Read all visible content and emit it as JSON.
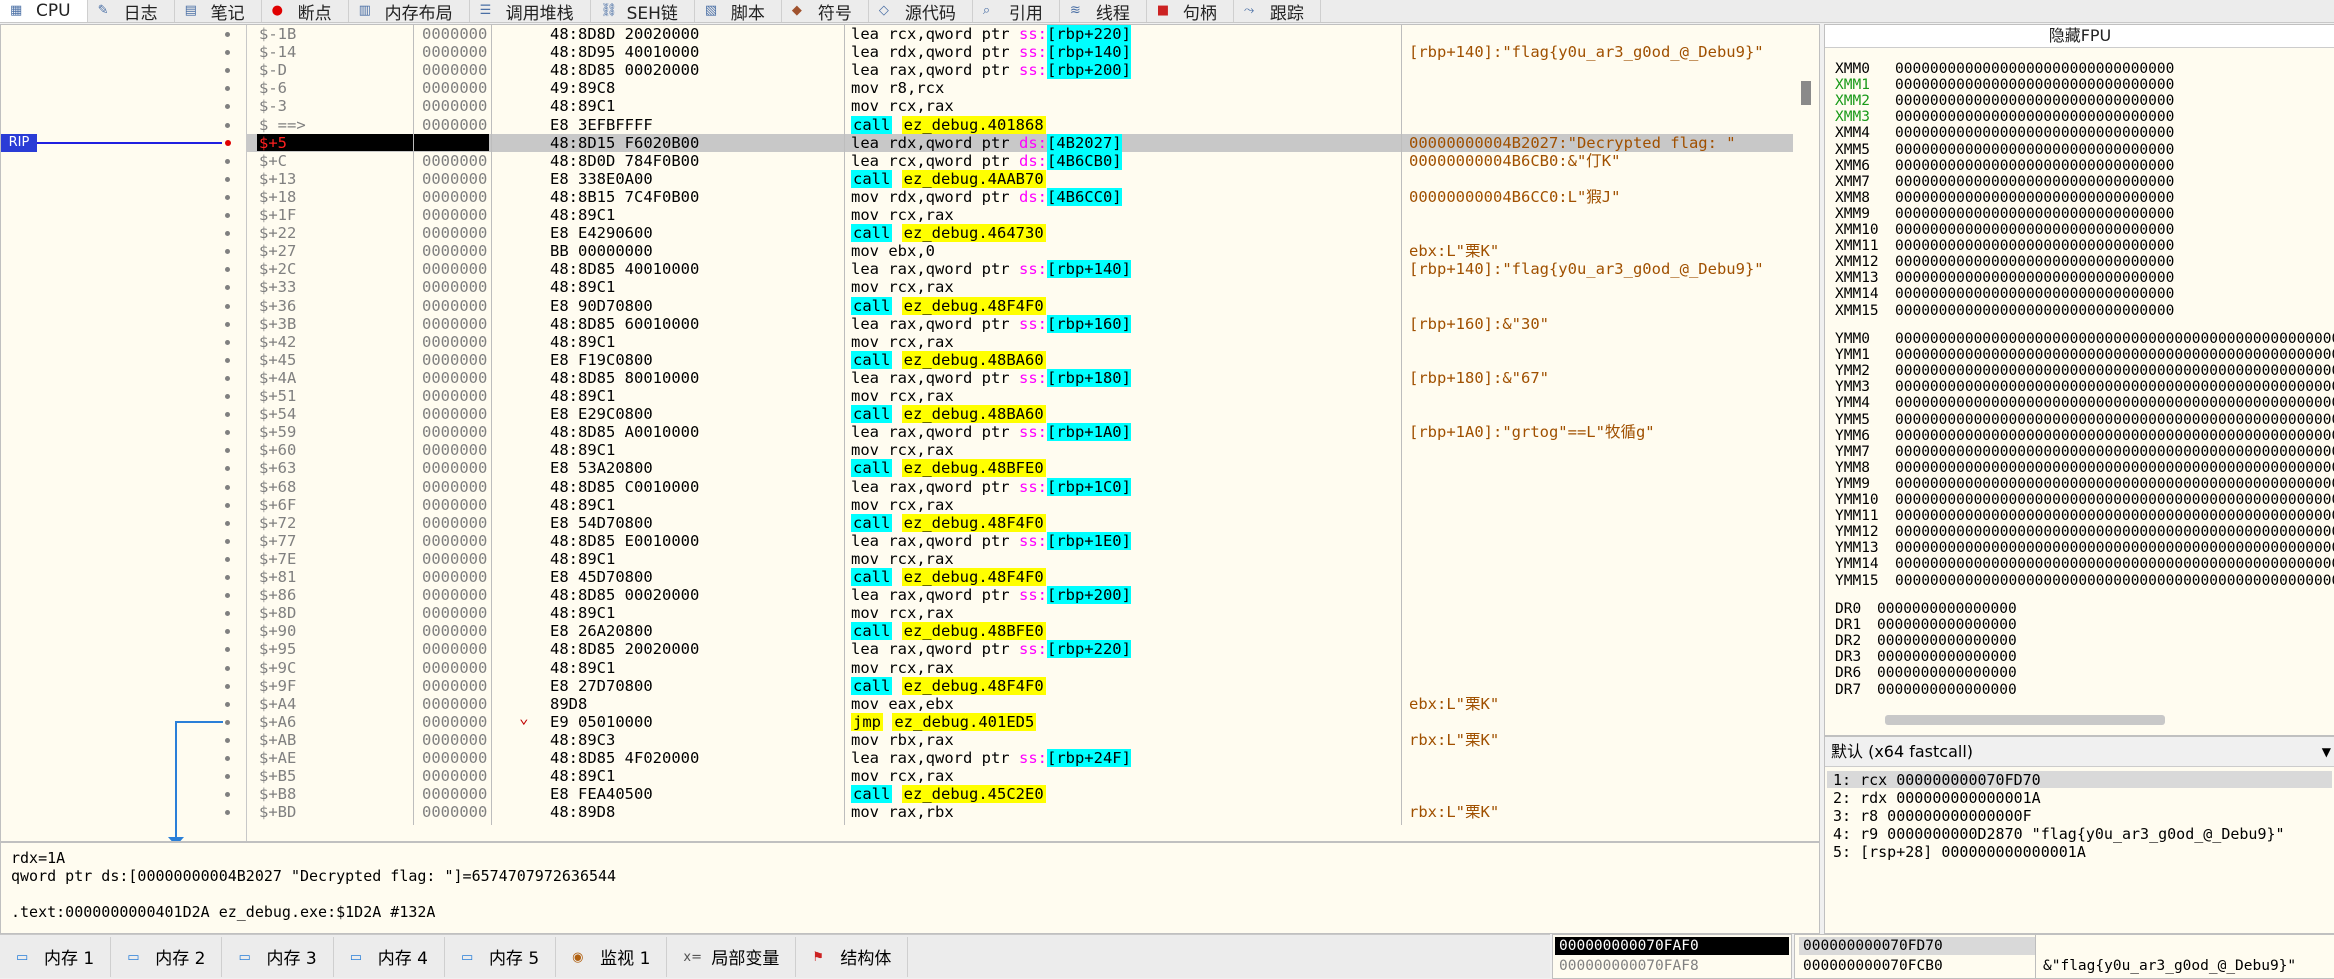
{
  "tabs": [
    {
      "label": "CPU",
      "icon": "cpu-icon",
      "active": true
    },
    {
      "label": "日志",
      "icon": "log-icon"
    },
    {
      "label": "笔记",
      "icon": "notes-icon"
    },
    {
      "label": "断点",
      "icon": "breakpoint-icon"
    },
    {
      "label": "内存布局",
      "icon": "memory-map-icon"
    },
    {
      "label": "调用堆栈",
      "icon": "call-stack-icon"
    },
    {
      "label": "SEH链",
      "icon": "seh-icon"
    },
    {
      "label": "脚本",
      "icon": "script-icon"
    },
    {
      "label": "符号",
      "icon": "symbols-icon"
    },
    {
      "label": "源代码",
      "icon": "source-icon"
    },
    {
      "label": "引用",
      "icon": "references-icon"
    },
    {
      "label": "线程",
      "icon": "threads-icon"
    },
    {
      "label": "句柄",
      "icon": "handles-icon"
    },
    {
      "label": "跟踪",
      "icon": "trace-icon"
    }
  ],
  "disasm": {
    "rip_label": "RIP",
    "rows": [
      {
        "label": "$-1B",
        "addr": "0000000",
        "bytes": "48:8D8D 20020000",
        "instr": [
          [
            "t",
            "lea rcx,qword ptr "
          ],
          [
            "s",
            "ss:"
          ],
          [
            "b",
            "[rbp+220]"
          ]
        ],
        "cmt": ""
      },
      {
        "label": "$-14",
        "addr": "0000000",
        "bytes": "48:8D95 40010000",
        "instr": [
          [
            "t",
            "lea rdx,qword ptr "
          ],
          [
            "s",
            "ss:"
          ],
          [
            "b",
            "[rbp+140]"
          ]
        ],
        "cmt": "[rbp+140]:\"flag{y0u_ar3_g0od_@_Debu9}\""
      },
      {
        "label": "$-D",
        "addr": "0000000",
        "bytes": "48:8D85 00020000",
        "instr": [
          [
            "t",
            "lea rax,qword ptr "
          ],
          [
            "s",
            "ss:"
          ],
          [
            "b",
            "[rbp+200]"
          ]
        ],
        "cmt": ""
      },
      {
        "label": "$-6",
        "addr": "0000000",
        "bytes": "49:89C8",
        "instr": [
          [
            "t",
            "mov r8,rcx"
          ]
        ],
        "cmt": ""
      },
      {
        "label": "$-3",
        "addr": "0000000",
        "bytes": "48:89C1",
        "instr": [
          [
            "t",
            "mov rcx,rax"
          ]
        ],
        "cmt": ""
      },
      {
        "label": "$ ==>",
        "addr": "0000000",
        "bytes": "E8 3EFBFFFF",
        "instr": [
          [
            "c",
            "call"
          ],
          [
            "t",
            " "
          ],
          [
            "y",
            "ez_debug.401868"
          ]
        ],
        "cmt": ""
      },
      {
        "label": "$+5",
        "addr": "0000000",
        "bytes": "48:8D15 F6020B00",
        "instr": [
          [
            "t",
            "lea rdx,qword ptr "
          ],
          [
            "s",
            "ds:"
          ],
          [
            "b",
            "[4B2027]"
          ]
        ],
        "cmt": "00000000004B2027:\"Decrypted flag: \"",
        "rip": true
      },
      {
        "label": "$+C",
        "addr": "0000000",
        "bytes": "48:8D0D 784F0B00",
        "instr": [
          [
            "t",
            "lea rcx,qword ptr "
          ],
          [
            "s",
            "ds:"
          ],
          [
            "b",
            "[4B6CB0]"
          ]
        ],
        "cmt": "00000000004B6CB0:&\"仃K\""
      },
      {
        "label": "$+13",
        "addr": "0000000",
        "bytes": "E8 338E0A00",
        "instr": [
          [
            "c",
            "call"
          ],
          [
            "t",
            " "
          ],
          [
            "y",
            "ez_debug.4AAB70"
          ]
        ],
        "cmt": ""
      },
      {
        "label": "$+18",
        "addr": "0000000",
        "bytes": "48:8B15 7C4F0B00",
        "instr": [
          [
            "t",
            "mov rdx,qword ptr "
          ],
          [
            "s",
            "ds:"
          ],
          [
            "b",
            "[4B6CC0]"
          ]
        ],
        "cmt": "00000000004B6CC0:L\"猳J\""
      },
      {
        "label": "$+1F",
        "addr": "0000000",
        "bytes": "48:89C1",
        "instr": [
          [
            "t",
            "mov rcx,rax"
          ]
        ],
        "cmt": ""
      },
      {
        "label": "$+22",
        "addr": "0000000",
        "bytes": "E8 E4290600",
        "instr": [
          [
            "c",
            "call"
          ],
          [
            "t",
            " "
          ],
          [
            "y",
            "ez_debug.464730"
          ]
        ],
        "cmt": ""
      },
      {
        "label": "$+27",
        "addr": "0000000",
        "bytes": "BB 00000000",
        "instr": [
          [
            "t",
            "mov ebx,0"
          ]
        ],
        "cmt": "ebx:L\"栗K\""
      },
      {
        "label": "$+2C",
        "addr": "0000000",
        "bytes": "48:8D85 40010000",
        "instr": [
          [
            "t",
            "lea rax,qword ptr "
          ],
          [
            "s",
            "ss:"
          ],
          [
            "b",
            "[rbp+140]"
          ]
        ],
        "cmt": "[rbp+140]:\"flag{y0u_ar3_g0od_@_Debu9}\""
      },
      {
        "label": "$+33",
        "addr": "0000000",
        "bytes": "48:89C1",
        "instr": [
          [
            "t",
            "mov rcx,rax"
          ]
        ],
        "cmt": ""
      },
      {
        "label": "$+36",
        "addr": "0000000",
        "bytes": "E8 90D70800",
        "instr": [
          [
            "c",
            "call"
          ],
          [
            "t",
            " "
          ],
          [
            "y",
            "ez_debug.48F4F0"
          ]
        ],
        "cmt": ""
      },
      {
        "label": "$+3B",
        "addr": "0000000",
        "bytes": "48:8D85 60010000",
        "instr": [
          [
            "t",
            "lea rax,qword ptr "
          ],
          [
            "s",
            "ss:"
          ],
          [
            "b",
            "[rbp+160]"
          ]
        ],
        "cmt": "[rbp+160]:&\"30\""
      },
      {
        "label": "$+42",
        "addr": "0000000",
        "bytes": "48:89C1",
        "instr": [
          [
            "t",
            "mov rcx,rax"
          ]
        ],
        "cmt": ""
      },
      {
        "label": "$+45",
        "addr": "0000000",
        "bytes": "E8 F19C0800",
        "instr": [
          [
            "c",
            "call"
          ],
          [
            "t",
            " "
          ],
          [
            "y",
            "ez_debug.48BA60"
          ]
        ],
        "cmt": ""
      },
      {
        "label": "$+4A",
        "addr": "0000000",
        "bytes": "48:8D85 80010000",
        "instr": [
          [
            "t",
            "lea rax,qword ptr "
          ],
          [
            "s",
            "ss:"
          ],
          [
            "b",
            "[rbp+180]"
          ]
        ],
        "cmt": "[rbp+180]:&\"67\""
      },
      {
        "label": "$+51",
        "addr": "0000000",
        "bytes": "48:89C1",
        "instr": [
          [
            "t",
            "mov rcx,rax"
          ]
        ],
        "cmt": ""
      },
      {
        "label": "$+54",
        "addr": "0000000",
        "bytes": "E8 E29C0800",
        "instr": [
          [
            "c",
            "call"
          ],
          [
            "t",
            " "
          ],
          [
            "y",
            "ez_debug.48BA60"
          ]
        ],
        "cmt": ""
      },
      {
        "label": "$+59",
        "addr": "0000000",
        "bytes": "48:8D85 A0010000",
        "instr": [
          [
            "t",
            "lea rax,qword ptr "
          ],
          [
            "s",
            "ss:"
          ],
          [
            "b",
            "[rbp+1A0]"
          ]
        ],
        "cmt": "[rbp+1A0]:\"grtog\"==L\"牧循g\""
      },
      {
        "label": "$+60",
        "addr": "0000000",
        "bytes": "48:89C1",
        "instr": [
          [
            "t",
            "mov rcx,rax"
          ]
        ],
        "cmt": ""
      },
      {
        "label": "$+63",
        "addr": "0000000",
        "bytes": "E8 53A20800",
        "instr": [
          [
            "c",
            "call"
          ],
          [
            "t",
            " "
          ],
          [
            "y",
            "ez_debug.48BFE0"
          ]
        ],
        "cmt": ""
      },
      {
        "label": "$+68",
        "addr": "0000000",
        "bytes": "48:8D85 C0010000",
        "instr": [
          [
            "t",
            "lea rax,qword ptr "
          ],
          [
            "s",
            "ss:"
          ],
          [
            "b",
            "[rbp+1C0]"
          ]
        ],
        "cmt": ""
      },
      {
        "label": "$+6F",
        "addr": "0000000",
        "bytes": "48:89C1",
        "instr": [
          [
            "t",
            "mov rcx,rax"
          ]
        ],
        "cmt": ""
      },
      {
        "label": "$+72",
        "addr": "0000000",
        "bytes": "E8 54D70800",
        "instr": [
          [
            "c",
            "call"
          ],
          [
            "t",
            " "
          ],
          [
            "y",
            "ez_debug.48F4F0"
          ]
        ],
        "cmt": ""
      },
      {
        "label": "$+77",
        "addr": "0000000",
        "bytes": "48:8D85 E0010000",
        "instr": [
          [
            "t",
            "lea rax,qword ptr "
          ],
          [
            "s",
            "ss:"
          ],
          [
            "b",
            "[rbp+1E0]"
          ]
        ],
        "cmt": ""
      },
      {
        "label": "$+7E",
        "addr": "0000000",
        "bytes": "48:89C1",
        "instr": [
          [
            "t",
            "mov rcx,rax"
          ]
        ],
        "cmt": ""
      },
      {
        "label": "$+81",
        "addr": "0000000",
        "bytes": "E8 45D70800",
        "instr": [
          [
            "c",
            "call"
          ],
          [
            "t",
            " "
          ],
          [
            "y",
            "ez_debug.48F4F0"
          ]
        ],
        "cmt": ""
      },
      {
        "label": "$+86",
        "addr": "0000000",
        "bytes": "48:8D85 00020000",
        "instr": [
          [
            "t",
            "lea rax,qword ptr "
          ],
          [
            "s",
            "ss:"
          ],
          [
            "b",
            "[rbp+200]"
          ]
        ],
        "cmt": ""
      },
      {
        "label": "$+8D",
        "addr": "0000000",
        "bytes": "48:89C1",
        "instr": [
          [
            "t",
            "mov rcx,rax"
          ]
        ],
        "cmt": ""
      },
      {
        "label": "$+90",
        "addr": "0000000",
        "bytes": "E8 26A20800",
        "instr": [
          [
            "c",
            "call"
          ],
          [
            "t",
            " "
          ],
          [
            "y",
            "ez_debug.48BFE0"
          ]
        ],
        "cmt": ""
      },
      {
        "label": "$+95",
        "addr": "0000000",
        "bytes": "48:8D85 20020000",
        "instr": [
          [
            "t",
            "lea rax,qword ptr "
          ],
          [
            "s",
            "ss:"
          ],
          [
            "b",
            "[rbp+220]"
          ]
        ],
        "cmt": ""
      },
      {
        "label": "$+9C",
        "addr": "0000000",
        "bytes": "48:89C1",
        "instr": [
          [
            "t",
            "mov rcx,rax"
          ]
        ],
        "cmt": ""
      },
      {
        "label": "$+9F",
        "addr": "0000000",
        "bytes": "E8 27D70800",
        "instr": [
          [
            "c",
            "call"
          ],
          [
            "t",
            " "
          ],
          [
            "y",
            "ez_debug.48F4F0"
          ]
        ],
        "cmt": ""
      },
      {
        "label": "$+A4",
        "addr": "0000000",
        "bytes": "89D8",
        "instr": [
          [
            "t",
            "mov eax,ebx"
          ]
        ],
        "cmt": "ebx:L\"栗K\""
      },
      {
        "label": "$+A6",
        "addr": "0000000",
        "bytes": "E9 05010000",
        "instr": [
          [
            "y",
            "jmp"
          ],
          [
            "t",
            " "
          ],
          [
            "y",
            "ez_debug.401ED5"
          ]
        ],
        "cmt": "",
        "jmp": true
      },
      {
        "label": "$+AB",
        "addr": "0000000",
        "bytes": "48:89C3",
        "instr": [
          [
            "t",
            "mov rbx,rax"
          ]
        ],
        "cmt": "rbx:L\"栗K\""
      },
      {
        "label": "$+AE",
        "addr": "0000000",
        "bytes": "48:8D85 4F020000",
        "instr": [
          [
            "t",
            "lea rax,qword ptr "
          ],
          [
            "s",
            "ss:"
          ],
          [
            "b",
            "[rbp+24F]"
          ]
        ],
        "cmt": ""
      },
      {
        "label": "$+B5",
        "addr": "0000000",
        "bytes": "48:89C1",
        "instr": [
          [
            "t",
            "mov rcx,rax"
          ]
        ],
        "cmt": ""
      },
      {
        "label": "$+B8",
        "addr": "0000000",
        "bytes": "E8 FEA40500",
        "instr": [
          [
            "c",
            "call"
          ],
          [
            "t",
            " "
          ],
          [
            "y",
            "ez_debug.45C2E0"
          ]
        ],
        "cmt": ""
      },
      {
        "label": "$+BD",
        "addr": "0000000",
        "bytes": "48:89D8",
        "instr": [
          [
            "t",
            "mov rax,rbx"
          ]
        ],
        "cmt": "rbx:L\"栗K\""
      }
    ]
  },
  "info": {
    "line1": "rdx=1A",
    "line2": "qword ptr ds:[00000000004B2027 \"Decrypted flag: \"]=6574707972636544",
    "line3": ".text:0000000000401D2A ez_debug.exe:$1D2A #132A"
  },
  "regs": {
    "title": "隐藏FPU",
    "xmm": [
      {
        "n": "XMM0",
        "v": "00000000000000000000000000000000"
      },
      {
        "n": "XMM1",
        "v": "00000000000000000000000000000000",
        "g": true
      },
      {
        "n": "XMM2",
        "v": "00000000000000000000000000000000",
        "g": true
      },
      {
        "n": "XMM3",
        "v": "00000000000000000000000000000000",
        "g": true
      },
      {
        "n": "XMM4",
        "v": "00000000000000000000000000000000"
      },
      {
        "n": "XMM5",
        "v": "00000000000000000000000000000000"
      },
      {
        "n": "XMM6",
        "v": "00000000000000000000000000000000"
      },
      {
        "n": "XMM7",
        "v": "00000000000000000000000000000000"
      },
      {
        "n": "XMM8",
        "v": "00000000000000000000000000000000"
      },
      {
        "n": "XMM9",
        "v": "00000000000000000000000000000000"
      },
      {
        "n": "XMM10",
        "v": "00000000000000000000000000000000"
      },
      {
        "n": "XMM11",
        "v": "00000000000000000000000000000000"
      },
      {
        "n": "XMM12",
        "v": "00000000000000000000000000000000"
      },
      {
        "n": "XMM13",
        "v": "00000000000000000000000000000000"
      },
      {
        "n": "XMM14",
        "v": "00000000000000000000000000000000"
      },
      {
        "n": "XMM15",
        "v": "00000000000000000000000000000000"
      }
    ],
    "ymm": [
      {
        "n": "YMM0",
        "v": "0000000000000000000000000000000000000000000000000000000000000000"
      },
      {
        "n": "YMM1",
        "v": "0000000000000000000000000000000000000000000000000000000000000000"
      },
      {
        "n": "YMM2",
        "v": "0000000000000000000000000000000000000000000000000000000000000000"
      },
      {
        "n": "YMM3",
        "v": "0000000000000000000000000000000000000000000000000000000000000000"
      },
      {
        "n": "YMM4",
        "v": "0000000000000000000000000000000000000000000000000000000000000000"
      },
      {
        "n": "YMM5",
        "v": "0000000000000000000000000000000000000000000000000000000000000000"
      },
      {
        "n": "YMM6",
        "v": "0000000000000000000000000000000000000000000000000000000000000000"
      },
      {
        "n": "YMM7",
        "v": "0000000000000000000000000000000000000000000000000000000000000000"
      },
      {
        "n": "YMM8",
        "v": "0000000000000000000000000000000000000000000000000000000000000000"
      },
      {
        "n": "YMM9",
        "v": "0000000000000000000000000000000000000000000000000000000000000000"
      },
      {
        "n": "YMM10",
        "v": "0000000000000000000000000000000000000000000000000000000000000000"
      },
      {
        "n": "YMM11",
        "v": "0000000000000000000000000000000000000000000000000000000000000000"
      },
      {
        "n": "YMM12",
        "v": "0000000000000000000000000000000000000000000000000000000000000000"
      },
      {
        "n": "YMM13",
        "v": "0000000000000000000000000000000000000000000000000000000000000000"
      },
      {
        "n": "YMM14",
        "v": "0000000000000000000000000000000000000000000000000000000000000000"
      },
      {
        "n": "YMM15",
        "v": "0000000000000000000000000000000000000000000000000000000000000000"
      }
    ],
    "dr": [
      {
        "n": "DR0",
        "v": "0000000000000000"
      },
      {
        "n": "DR1",
        "v": "0000000000000000"
      },
      {
        "n": "DR2",
        "v": "0000000000000000"
      },
      {
        "n": "DR3",
        "v": "0000000000000000"
      },
      {
        "n": "DR6",
        "v": "0000000000000000"
      },
      {
        "n": "DR7",
        "v": "0000000000000000"
      }
    ]
  },
  "callconv": {
    "selected": "默认 (x64 fastcall)",
    "args": [
      "1: rcx 000000000070FD70",
      "2: rdx 000000000000001A",
      "3: r8 000000000000000F",
      "4: r9 0000000000D2870 \"flag{y0u_ar3_g0od_@_Debu9}\"",
      "5: [rsp+28] 000000000000001A"
    ]
  },
  "bottom_tabs": [
    {
      "label": "内存 1",
      "icon": "memory-icon"
    },
    {
      "label": "内存 2",
      "icon": "memory-icon"
    },
    {
      "label": "内存 3",
      "icon": "memory-icon"
    },
    {
      "label": "内存 4",
      "icon": "memory-icon"
    },
    {
      "label": "内存 5",
      "icon": "memory-icon"
    },
    {
      "label": "监视 1",
      "icon": "watch-icon"
    },
    {
      "label": "局部变量",
      "icon": "locals-icon"
    },
    {
      "label": "结构体",
      "icon": "struct-icon"
    }
  ],
  "dump": {
    "addr_selected": "000000000070FAF0",
    "addr_next": "000000000070FAF8"
  },
  "stack": {
    "row1_addr": "000000000070FD70",
    "row2_addr": "000000000070FCB0",
    "row2_val": "&\"flag{y0u_ar3_g0od_@_Debu9}\""
  },
  "colors": {
    "rip": "#2a3cd6",
    "call_highlight": "#ffff00",
    "bracket_highlight": "#00ffff",
    "segment": "#ff00ff",
    "comment": "#a05000"
  }
}
